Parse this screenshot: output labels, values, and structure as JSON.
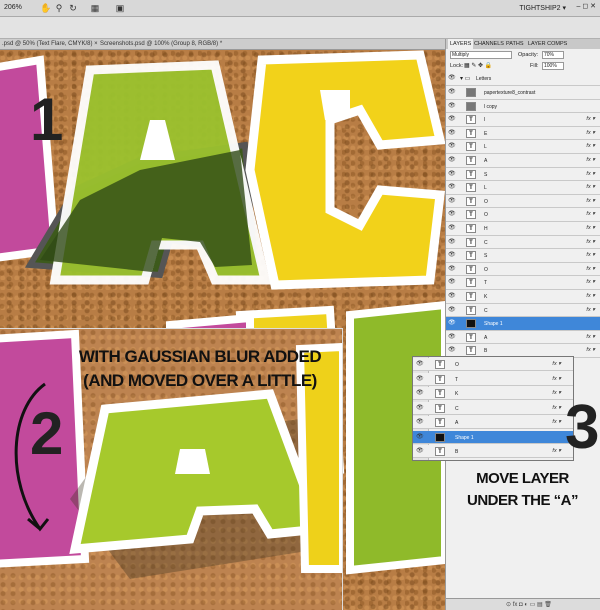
{
  "topbar": {
    "zoom": "206%",
    "workspace": "TIGHTSHIP2 ▾",
    "icons": [
      "hand-icon",
      "zoom-icon",
      "rotate-icon",
      "arrange-icon",
      "screen-mode-icon"
    ]
  },
  "doc_tabs": [
    ".psd @ 50% (Text Flare, CMYK/8) ×",
    "Screenshots.psd @ 100% (Group 8, RGB/8) *"
  ],
  "canvas": {
    "step1": "1",
    "step2": "2",
    "step3": "3",
    "caption2_line1": "WITH GAUSSIAN BLUR ADDED",
    "caption2_line2": "(AND MOVED OVER A LITTLE)",
    "caption3_line1": "MOVE LAYER",
    "caption3_line2": "UNDER THE “A”",
    "colors": {
      "cork": "#b87d45",
      "letter_green": "#9bc22e",
      "letter_yellow": "#f2d21a",
      "letter_pink": "#c24a9c",
      "shadow_dark": "#3d5a1c",
      "caption": "#111111"
    }
  },
  "panel": {
    "tabs": [
      "LAYERS",
      "CHANNELS",
      "PATHS",
      "LAYER COMPS"
    ],
    "blend_mode": "Multiply",
    "opacity_label": "Opacity:",
    "opacity_value": "70%",
    "lock_label": "Lock:",
    "fill_label": "Fill:",
    "fill_value": "100%",
    "group_name": "Letters",
    "layers": [
      {
        "name": "papertexture8_contrast",
        "type": "image",
        "fx": false
      },
      {
        "name": "l copy",
        "type": "image",
        "fx": false
      },
      {
        "name": "I",
        "type": "text",
        "fx": true
      },
      {
        "name": "E",
        "type": "text",
        "fx": true
      },
      {
        "name": "L",
        "type": "text",
        "fx": true
      },
      {
        "name": "A",
        "type": "text",
        "fx": true
      },
      {
        "name": "S",
        "type": "text",
        "fx": true
      },
      {
        "name": "L",
        "type": "text",
        "fx": true
      },
      {
        "name": "O",
        "type": "text",
        "fx": true
      },
      {
        "name": "O",
        "type": "text",
        "fx": true
      },
      {
        "name": "H",
        "type": "text",
        "fx": true
      },
      {
        "name": "C",
        "type": "text",
        "fx": true
      },
      {
        "name": "S",
        "type": "text",
        "fx": true
      },
      {
        "name": "O",
        "type": "text",
        "fx": true
      },
      {
        "name": "T",
        "type": "text",
        "fx": true
      },
      {
        "name": "K",
        "type": "text",
        "fx": true
      },
      {
        "name": "C",
        "type": "text",
        "fx": true
      },
      {
        "name": "Shape 1",
        "type": "shape",
        "fx": false,
        "selected": true
      },
      {
        "name": "A",
        "type": "text",
        "fx": true
      },
      {
        "name": "B",
        "type": "text",
        "fx": true
      }
    ],
    "bottom_icons": "⊙ fx ◘ ◐ ▭ ▤ 🗑"
  },
  "zoom_panel": {
    "layers": [
      {
        "name": "O",
        "type": "text",
        "fx": true
      },
      {
        "name": "T",
        "type": "text",
        "fx": true
      },
      {
        "name": "K",
        "type": "text",
        "fx": true
      },
      {
        "name": "C",
        "type": "text",
        "fx": true
      },
      {
        "name": "A",
        "type": "text",
        "fx": true
      },
      {
        "name": "Shape 1",
        "type": "shape",
        "fx": false,
        "selected": true
      },
      {
        "name": "B",
        "type": "text",
        "fx": true
      }
    ]
  }
}
